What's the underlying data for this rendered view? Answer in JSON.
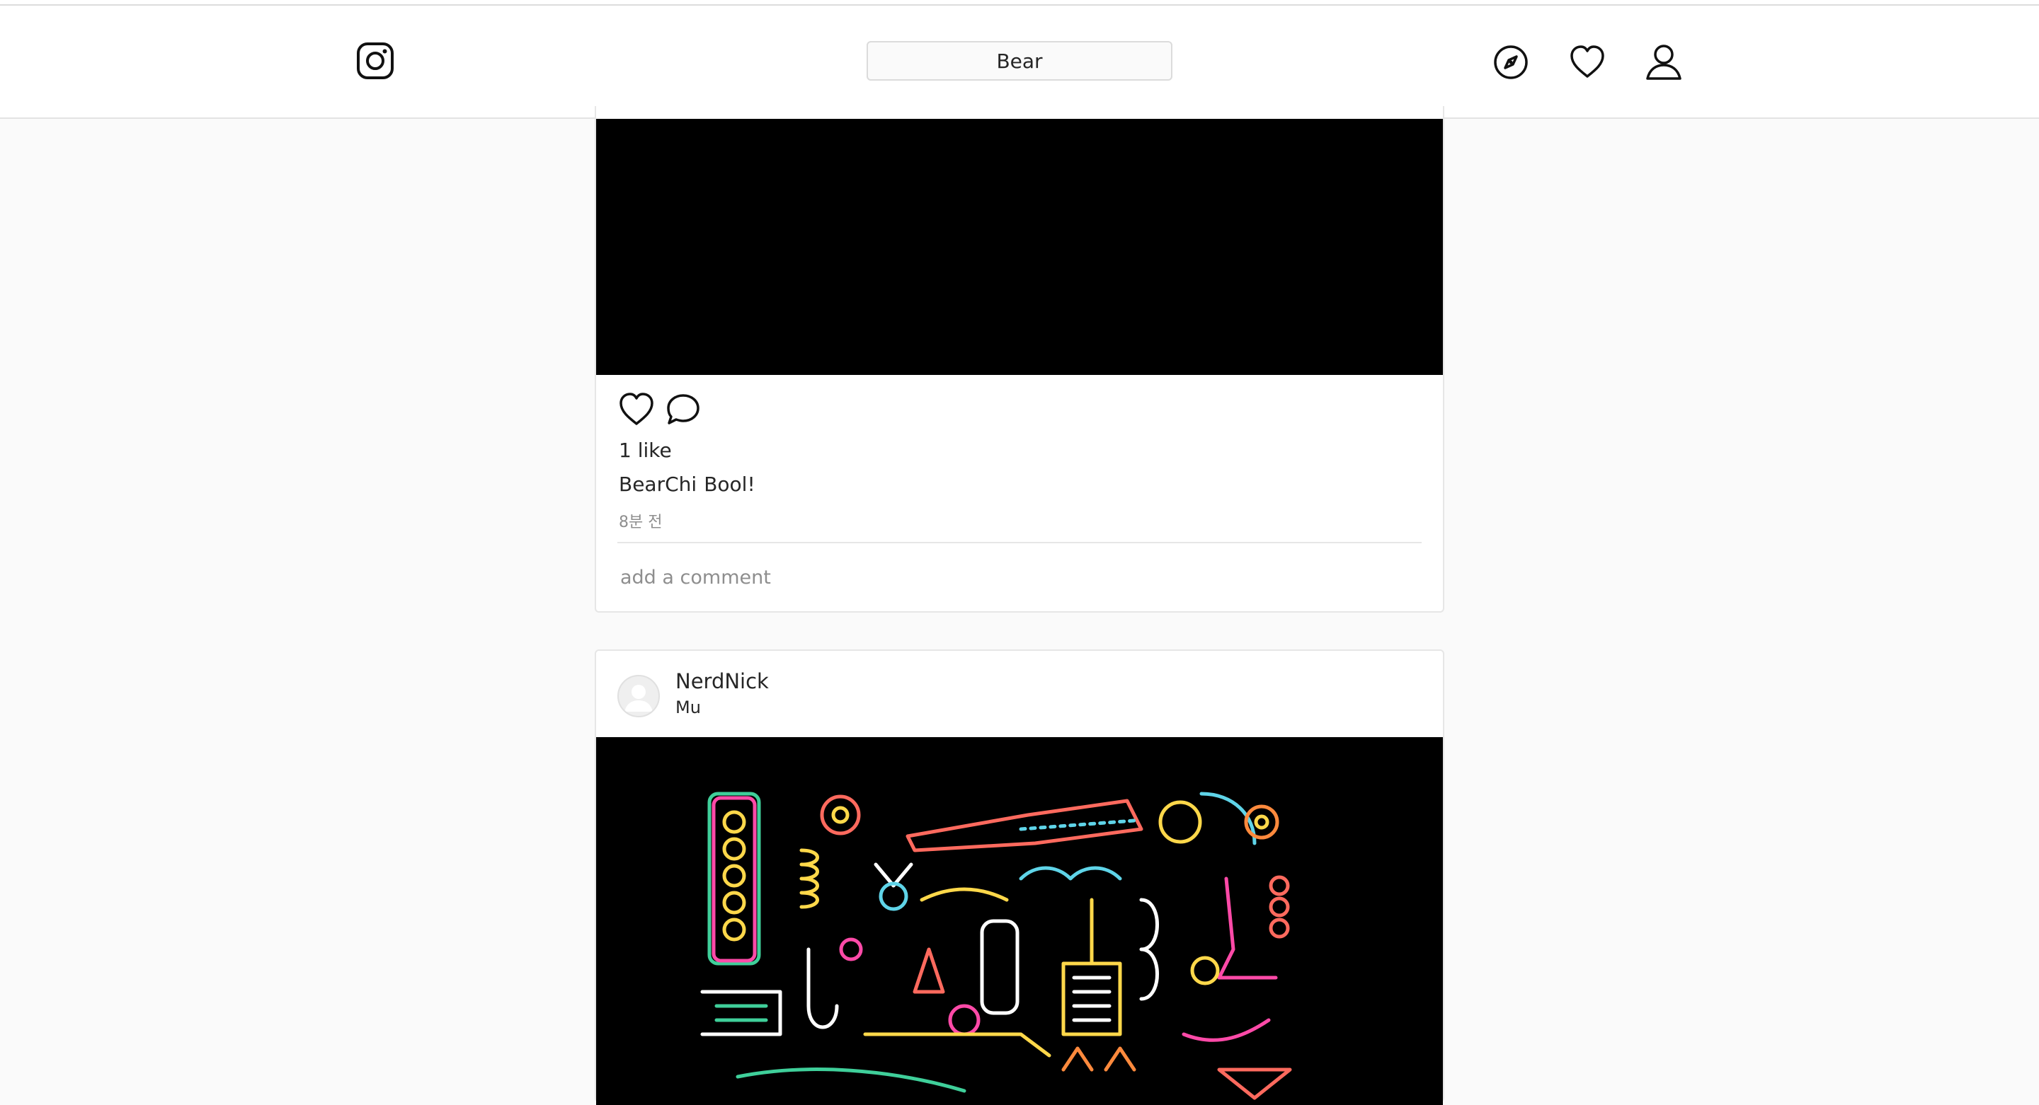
{
  "header": {
    "logo_icon": "instagram-icon",
    "search_value": "Bear",
    "nav_icons": [
      "compass-icon",
      "heart-icon",
      "user-icon"
    ]
  },
  "posts": [
    {
      "likes": "1 like",
      "author": "BearChi",
      "caption": "Bool!",
      "time": "8분 전",
      "comment_placeholder": "add a comment"
    },
    {
      "username": "NerdNick",
      "location": "Mu",
      "image": "neon-bar-illustration"
    }
  ],
  "colors": {
    "background": "#fafafa",
    "card": "#ffffff",
    "border": "#e6e6e6",
    "muted": "#8e8e8e",
    "media": "#000000"
  }
}
